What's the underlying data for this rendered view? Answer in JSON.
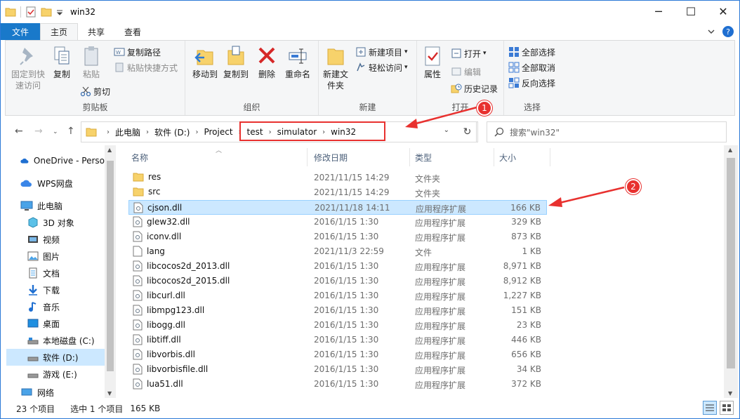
{
  "window": {
    "title": "win32",
    "controls": {
      "minimize": "─",
      "maximize": "☐",
      "close": "✕"
    }
  },
  "tabs": [
    "文件",
    "主页",
    "共享",
    "查看"
  ],
  "ribbon": {
    "clipboard": {
      "label": "剪贴板",
      "pin": "固定到快速访问",
      "copy": "复制",
      "paste": "粘贴",
      "copy_path": "复制路径",
      "paste_shortcut": "粘贴快捷方式",
      "cut": "剪切"
    },
    "organize": {
      "label": "组织",
      "move_to": "移动到",
      "copy_to": "复制到",
      "delete": "删除",
      "rename": "重命名"
    },
    "new": {
      "label": "新建",
      "new_folder": "新建文件夹",
      "new_item": "新建项目",
      "easy_access": "轻松访问"
    },
    "open": {
      "label": "打开",
      "properties": "属性",
      "open": "打开",
      "edit": "编辑",
      "history": "历史记录"
    },
    "select": {
      "label": "选择",
      "select_all": "全部选择",
      "select_none": "全部取消",
      "invert": "反向选择"
    }
  },
  "address": {
    "crumbs": [
      "此电脑",
      "软件 (D:)",
      "Project",
      "test",
      "simulator",
      "win32"
    ]
  },
  "search": {
    "placeholder": "搜索\"win32\""
  },
  "nav": [
    {
      "label": "OneDrive - Perso",
      "icon": "cloud-icon"
    },
    {
      "label": "WPS网盘",
      "icon": "wps-cloud-icon"
    },
    {
      "label": "此电脑",
      "icon": "computer-icon"
    },
    {
      "label": "3D 对象",
      "icon": "cube-icon"
    },
    {
      "label": "视频",
      "icon": "video-icon"
    },
    {
      "label": "图片",
      "icon": "picture-icon"
    },
    {
      "label": "文档",
      "icon": "document-icon"
    },
    {
      "label": "下载",
      "icon": "download-icon"
    },
    {
      "label": "音乐",
      "icon": "music-icon"
    },
    {
      "label": "桌面",
      "icon": "desktop-icon"
    },
    {
      "label": "本地磁盘 (C:)",
      "icon": "drive-icon"
    },
    {
      "label": "软件 (D:)",
      "icon": "drive-icon"
    },
    {
      "label": "游戏 (E:)",
      "icon": "drive-icon"
    },
    {
      "label": "网络",
      "icon": "network-icon"
    }
  ],
  "columns": {
    "name": "名称",
    "modified": "修改日期",
    "type": "类型",
    "size": "大小"
  },
  "files": [
    {
      "name": "res",
      "date": "2021/11/15 14:29",
      "type": "文件夹",
      "size": "",
      "kind": "folder"
    },
    {
      "name": "src",
      "date": "2021/11/15 14:29",
      "type": "文件夹",
      "size": "",
      "kind": "folder"
    },
    {
      "name": "cjson.dll",
      "date": "2021/11/18 14:11",
      "type": "应用程序扩展",
      "size": "166 KB",
      "kind": "dll",
      "selected": true
    },
    {
      "name": "glew32.dll",
      "date": "2016/1/15 1:30",
      "type": "应用程序扩展",
      "size": "329 KB",
      "kind": "dll"
    },
    {
      "name": "iconv.dll",
      "date": "2016/1/15 1:30",
      "type": "应用程序扩展",
      "size": "873 KB",
      "kind": "dll"
    },
    {
      "name": "lang",
      "date": "2021/11/3 22:59",
      "type": "文件",
      "size": "1 KB",
      "kind": "file"
    },
    {
      "name": "libcocos2d_2013.dll",
      "date": "2016/1/15 1:30",
      "type": "应用程序扩展",
      "size": "8,971 KB",
      "kind": "dll"
    },
    {
      "name": "libcocos2d_2015.dll",
      "date": "2016/1/15 1:30",
      "type": "应用程序扩展",
      "size": "8,912 KB",
      "kind": "dll"
    },
    {
      "name": "libcurl.dll",
      "date": "2016/1/15 1:30",
      "type": "应用程序扩展",
      "size": "1,227 KB",
      "kind": "dll"
    },
    {
      "name": "libmpg123.dll",
      "date": "2016/1/15 1:30",
      "type": "应用程序扩展",
      "size": "151 KB",
      "kind": "dll"
    },
    {
      "name": "libogg.dll",
      "date": "2016/1/15 1:30",
      "type": "应用程序扩展",
      "size": "23 KB",
      "kind": "dll"
    },
    {
      "name": "libtiff.dll",
      "date": "2016/1/15 1:30",
      "type": "应用程序扩展",
      "size": "446 KB",
      "kind": "dll"
    },
    {
      "name": "libvorbis.dll",
      "date": "2016/1/15 1:30",
      "type": "应用程序扩展",
      "size": "656 KB",
      "kind": "dll"
    },
    {
      "name": "libvorbisfile.dll",
      "date": "2016/1/15 1:30",
      "type": "应用程序扩展",
      "size": "34 KB",
      "kind": "dll"
    },
    {
      "name": "lua51.dll",
      "date": "2016/1/15 1:30",
      "type": "应用程序扩展",
      "size": "372 KB",
      "kind": "dll"
    }
  ],
  "status": {
    "count": "23 个项目",
    "selection": "选中 1 个项目",
    "size": "165 KB"
  },
  "annotations": [
    "1",
    "2"
  ],
  "colors": {
    "accent": "#1979ca",
    "selection": "#cce8ff",
    "annotation": "#e8312f"
  }
}
